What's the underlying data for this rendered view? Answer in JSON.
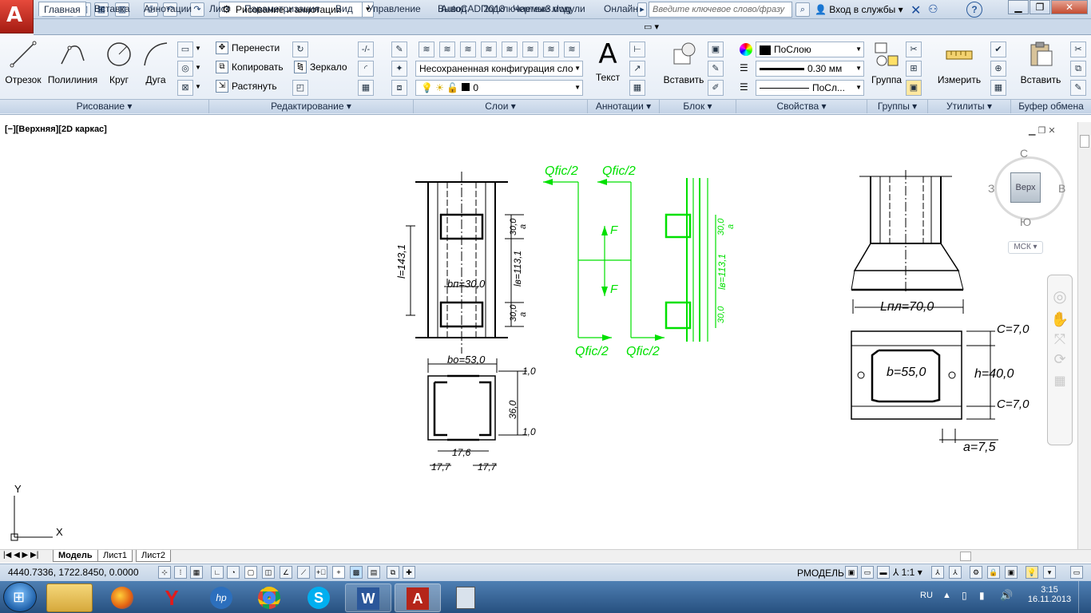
{
  "titlebar": {
    "app_name": "AutoCAD 2013",
    "file_name": "Чертеж3.dwg",
    "workspace": "Рисование и аннотации",
    "search_placeholder": "Введите ключевое слово/фразу",
    "signin": "Вход в службы",
    "help": "?"
  },
  "tabs": [
    "Главная",
    "Вставка",
    "Аннотации",
    "Лист",
    "Параметризация",
    "Вид",
    "Управление",
    "Вывод",
    "Подключаемые модули",
    "Онлайн"
  ],
  "ribbon": {
    "draw": {
      "title": "Рисование",
      "tools": [
        "Отрезок",
        "Полилиния",
        "Круг",
        "Дуга"
      ]
    },
    "modify": {
      "title": "Редактирование",
      "tools": [
        "Перенести",
        "Копировать",
        "Растянуть",
        "Зеркало"
      ]
    },
    "layers": {
      "title": "Слои",
      "state": "Несохраненная конфигурация сло",
      "current": "0"
    },
    "annotation": {
      "title": "Аннотации",
      "tool": "Текст"
    },
    "block": {
      "title": "Блок",
      "tool": "Вставить"
    },
    "properties": {
      "title": "Свойства",
      "color": "ПоСлою",
      "lineweight": "0.30 мм",
      "linetype": "ПоСл..."
    },
    "groups": {
      "title": "Группы",
      "tool": "Группа"
    },
    "utilities": {
      "title": "Утилиты",
      "tool": "Измерить"
    },
    "clipboard": {
      "title": "Буфер обмена",
      "tool": "Вставить"
    }
  },
  "viewport": {
    "label": "[−][Верхняя][2D каркас]",
    "viewcube": {
      "face": "Верх",
      "n": "С",
      "s": "Ю",
      "w": "З",
      "e": "В",
      "ucs": "МСК"
    }
  },
  "drawing": {
    "left": {
      "l": "l=143,1",
      "bn": "bп=30,0",
      "lb": "lв=113,1",
      "d1": "30,0",
      "d2": "30,0",
      "a1": "a",
      "a2": "a",
      "bo": "bо=53,0",
      "d3": "1,0",
      "d4": "1,0",
      "h": "36,0",
      "w": "17,6",
      "s1": "17,7",
      "s2": "17,7"
    },
    "forces": {
      "q1": "Qfic/2",
      "q2": "Qfic/2",
      "q3": "Qfic/2",
      "q4": "Qfic/2",
      "f1": "F",
      "f2": "F",
      "r1": "30,0",
      "r2": "lв=113,1",
      "r3": "30,0",
      "ra": "a"
    },
    "right": {
      "lpl": "Lпл=70,0",
      "b": "b=55,0",
      "h": "h=40,0",
      "c1": "C=7,0",
      "c2": "C=7,0",
      "a": "a=7,5"
    }
  },
  "ucs_axes": {
    "x": "X",
    "y": "Y"
  },
  "layout_tabs": [
    "Модель",
    "Лист1",
    "Лист2"
  ],
  "status": {
    "coords": "4440.7336, 1722.8450, 0.0000",
    "mode": "РМОДЕЛЬ",
    "scale": "1:1"
  },
  "tray": {
    "lang": "RU",
    "time": "3:15",
    "date": "16.11.2013"
  },
  "colors": {
    "accent": "#1b7ac4",
    "drawing_green": "#00e000"
  }
}
